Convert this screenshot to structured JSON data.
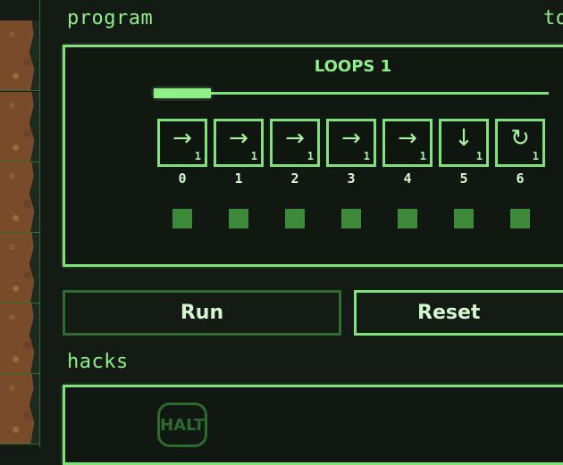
{
  "header": {
    "program_label": "program",
    "right_label": "to"
  },
  "program": {
    "loops_title": "LOOPS 1",
    "loop_progress": 0.15,
    "slots": [
      {
        "index": "0",
        "icon": "arrow-right-icon",
        "glyph": "→",
        "count": "1"
      },
      {
        "index": "1",
        "icon": "arrow-right-icon",
        "glyph": "→",
        "count": "1"
      },
      {
        "index": "2",
        "icon": "arrow-right-icon",
        "glyph": "→",
        "count": "1"
      },
      {
        "index": "3",
        "icon": "arrow-right-icon",
        "glyph": "→",
        "count": "1"
      },
      {
        "index": "4",
        "icon": "arrow-right-icon",
        "glyph": "→",
        "count": "1"
      },
      {
        "index": "5",
        "icon": "arrow-down-icon",
        "glyph": "↓",
        "count": "1"
      },
      {
        "index": "6",
        "icon": "rotate-icon",
        "glyph": "↻",
        "count": "1"
      }
    ]
  },
  "controls": {
    "run_label": "Run",
    "reset_label": "Reset"
  },
  "hacks": {
    "label": "hacks",
    "halt_label": "HALT"
  },
  "colors": {
    "accent": "#7fe27a",
    "background": "#141a14",
    "terrain": "#7a4b2a"
  }
}
